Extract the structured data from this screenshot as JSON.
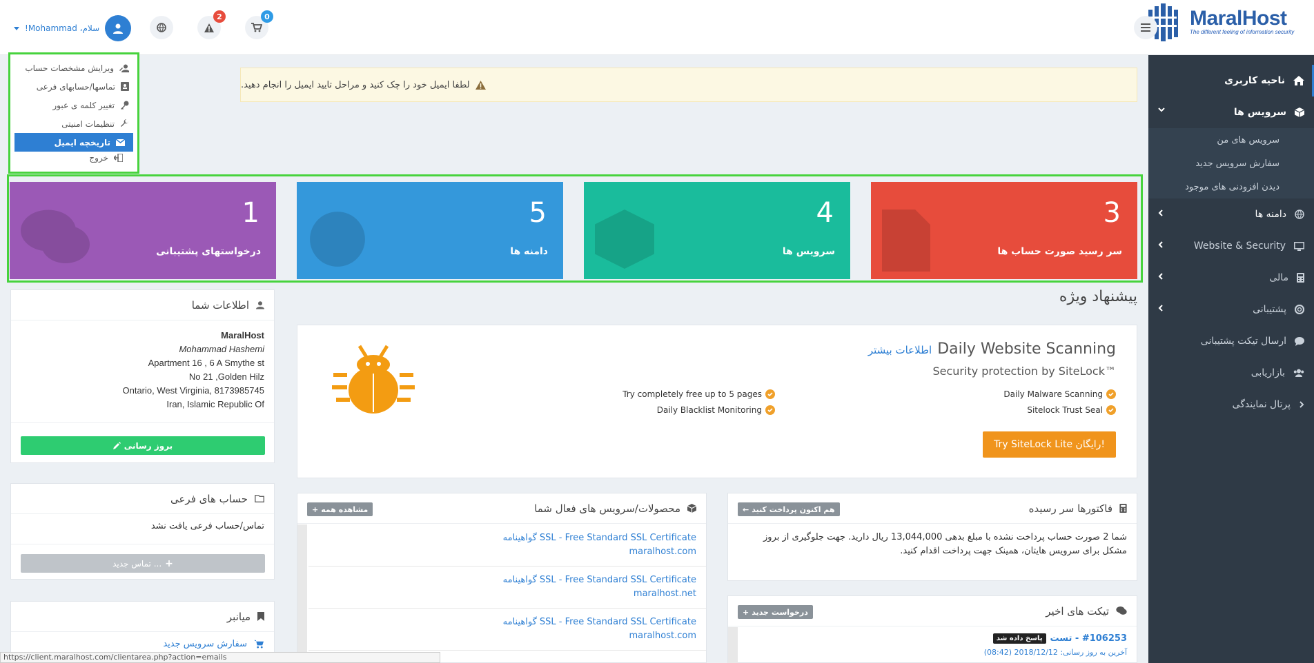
{
  "logo": {
    "brand": "MaralHost",
    "tagline": "The different feeling of information security"
  },
  "header": {
    "greeting": "سلام، Mohammad!",
    "notifications_count": "2",
    "cart_count": "0"
  },
  "account_menu": {
    "items": [
      {
        "label": "ویرایش مشخصات حساب"
      },
      {
        "label": "تماسها/حسابهای فرعی"
      },
      {
        "label": "تغییر کلمه ی عبور"
      },
      {
        "label": "تنظیمات امنیتی"
      },
      {
        "label": "تاریخچه ایمیل"
      }
    ],
    "logout": "خروج"
  },
  "sidebar": {
    "items": [
      {
        "label": "ناحیه کاربری"
      },
      {
        "label": "سرویس ها"
      },
      {
        "label": "دامنه ها"
      },
      {
        "label": "Website & Security"
      },
      {
        "label": "مالی"
      },
      {
        "label": "پشتیبانی"
      },
      {
        "label": "ارسال تیکت پشتیبانی"
      },
      {
        "label": "بازاریابی"
      },
      {
        "label": "پرتال نمایندگی"
      }
    ],
    "subitems": [
      {
        "label": "سرویس های من"
      },
      {
        "label": "سفارش سرویس جدید"
      },
      {
        "label": "دیدن افزودنی های موجود"
      }
    ]
  },
  "alert": {
    "text": "لطفا ایمیل خود را چک کنید و مراحل تایید ایمیل را انجام دهید."
  },
  "stats": [
    {
      "value": "3",
      "label": "سر رسید صورت حساب ها",
      "color": "#e74c3c"
    },
    {
      "value": "4",
      "label": "سرویس ها",
      "color": "#1abc9c"
    },
    {
      "value": "5",
      "label": "دامنه ها",
      "color": "#3498db"
    },
    {
      "value": "1",
      "label": "درخواستهای پشتیبانی",
      "color": "#9b59b6"
    }
  ],
  "promo": {
    "section_title": "پیشنهاد ویژه",
    "title": "Daily Website Scanning",
    "more_link": "اطلاعات بیشتر",
    "subtitle": "Security protection by SiteLock™",
    "features": [
      "Daily Malware Scanning",
      "Sitelock Trust Seal",
      "Try completely free up to 5 pages",
      "Daily Blacklist Monitoring"
    ],
    "cta": "Try SiteLock Lite رایگان!"
  },
  "info_panel": {
    "title": "اطلاعات شما",
    "company": "MaralHost",
    "name": "Mohammad Hashemi",
    "address1": "Apartment 16 , 6 A Smythe st",
    "address2": "No 21 ,Golden Hilz",
    "address3": "Ontario, West Virginia, 8173985745",
    "country": "Iran, Islamic Republic Of",
    "update_button": "بروز رسانی"
  },
  "subaccounts_panel": {
    "title": "حساب های فرعی",
    "empty": "تماس/حساب فرعی یافت نشد",
    "new_button": "تماس جدید ..."
  },
  "shortcuts_panel": {
    "title": "میانبر",
    "link": "سفارش سرویس جدید"
  },
  "services_panel": {
    "title": "محصولات/سرویس های فعال شما",
    "view_all": "مشاهده همه",
    "rows": [
      {
        "name": "گواهینامه SSL - Free Standard SSL Certificate",
        "domain": "maralhost.com"
      },
      {
        "name": "گواهینامه SSL - Free Standard SSL Certificate",
        "domain": "maralhost.net"
      },
      {
        "name": "گواهینامه SSL - Free Standard SSL Certificate",
        "domain": "maralhost.com"
      }
    ]
  },
  "invoices_panel": {
    "title": "فاکتورها سر رسیده",
    "pay_button": "هم اکنون پرداخت کنید",
    "text": "شما 2 صورت حساب پرداخت نشده با مبلغ بدهی 13,044,000 ریال دارید. جهت جلوگیری از بروز مشکل برای سرویس هایتان، همینک جهت پرداخت اقدام کنید."
  },
  "tickets_panel": {
    "title": "تیکت های اخیر",
    "new_button": "درخواست جدید",
    "ticket_id": "#106253 - تست",
    "status": "پاسخ داده شد",
    "updated": "آخرین به روز رسانی: 2018/12/12 (08:42)"
  },
  "status_bar": {
    "url": "https://client.maralhost.com/clientarea.php?action=emails"
  }
}
